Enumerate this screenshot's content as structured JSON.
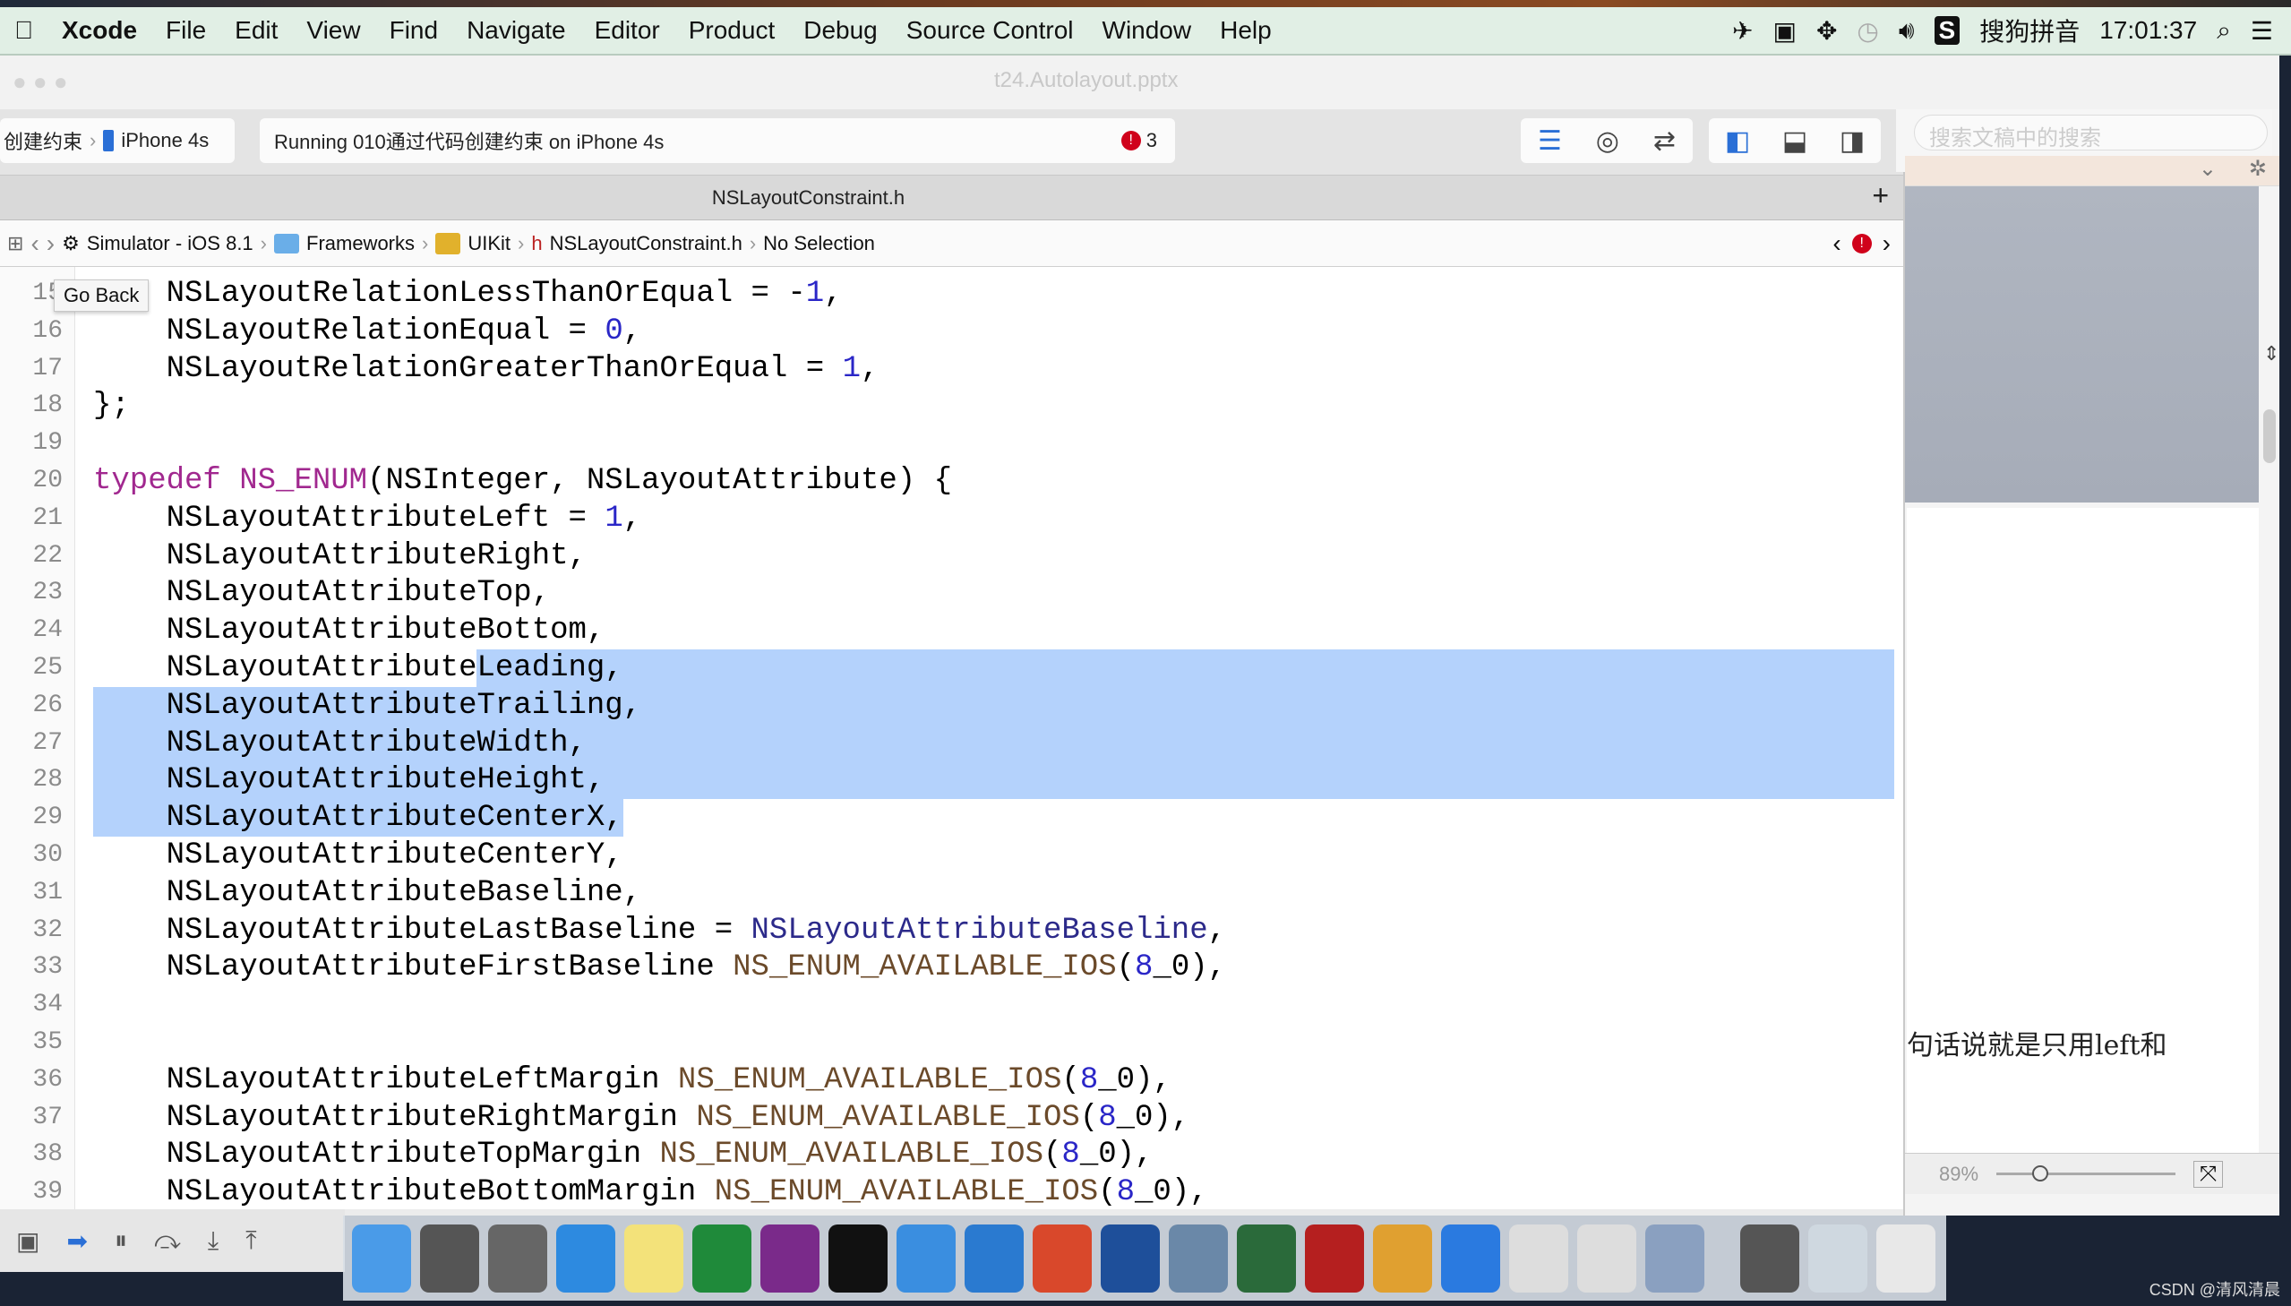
{
  "menubar": {
    "app": "Xcode",
    "items": [
      "File",
      "Edit",
      "View",
      "Find",
      "Navigate",
      "Editor",
      "Product",
      "Debug",
      "Source Control",
      "Window",
      "Help"
    ],
    "ime": "搜狗拼音",
    "clock": "17:01:37"
  },
  "window": {
    "title": "t24.Autolayout.pptx"
  },
  "toolbar": {
    "scheme": "创建约束",
    "device": "iPhone 4s",
    "status": "Running 010通过代码创建约束 on iPhone 4s",
    "error_count": "3"
  },
  "tab": {
    "title": "NSLayoutConstraint.h"
  },
  "jumpbar": {
    "items": [
      "Simulator - iOS 8.1",
      "Frameworks",
      "UIKit",
      "NSLayoutConstraint.h",
      "No Selection"
    ]
  },
  "tooltip": "Go Back",
  "code": [
    {
      "n": "15",
      "t": [
        [
          "NSLayoutRelationLessThanOrEqual = -",
          ""
        ],
        [
          "1",
          "num"
        ],
        [
          ",",
          ""
        ]
      ],
      "indent": 1
    },
    {
      "n": "16",
      "t": [
        [
          "NSLayoutRelationEqual = ",
          ""
        ],
        [
          "0",
          "num"
        ],
        [
          ",",
          ""
        ]
      ],
      "indent": 1
    },
    {
      "n": "17",
      "t": [
        [
          "NSLayoutRelationGreaterThanOrEqual = ",
          ""
        ],
        [
          "1",
          "num"
        ],
        [
          ",",
          ""
        ]
      ],
      "indent": 1
    },
    {
      "n": "18",
      "t": [
        [
          "};",
          ""
        ]
      ],
      "indent": 0
    },
    {
      "n": "19",
      "t": [],
      "indent": 0
    },
    {
      "n": "20",
      "t": [
        [
          "typedef",
          "kw"
        ],
        [
          " ",
          ""
        ],
        [
          "NS_ENUM",
          "kw"
        ],
        [
          "(NSInteger, NSLayoutAttribute) {",
          ""
        ]
      ],
      "indent": 0
    },
    {
      "n": "21",
      "t": [
        [
          "NSLayoutAttributeLeft = ",
          ""
        ],
        [
          "1",
          "num"
        ],
        [
          ",",
          ""
        ]
      ],
      "indent": 1
    },
    {
      "n": "22",
      "t": [
        [
          "NSLayoutAttributeRight,",
          ""
        ]
      ],
      "indent": 1
    },
    {
      "n": "23",
      "t": [
        [
          "NSLayoutAttributeTop,",
          ""
        ]
      ],
      "indent": 1
    },
    {
      "n": "24",
      "t": [
        [
          "NSLayoutAttributeBottom,",
          ""
        ]
      ],
      "indent": 1
    },
    {
      "n": "25",
      "t": [
        [
          "NSLayoutAttributeLeading,",
          ""
        ]
      ],
      "indent": 1
    },
    {
      "n": "26",
      "t": [
        [
          "NSLayoutAttributeTrailing,",
          ""
        ]
      ],
      "indent": 1
    },
    {
      "n": "27",
      "t": [
        [
          "NSLayoutAttributeWidth,",
          ""
        ]
      ],
      "indent": 1
    },
    {
      "n": "28",
      "t": [
        [
          "NSLayoutAttributeHeight,",
          ""
        ]
      ],
      "indent": 1
    },
    {
      "n": "29",
      "t": [
        [
          "NSLayoutAttributeCenterX,",
          ""
        ]
      ],
      "indent": 1
    },
    {
      "n": "30",
      "t": [
        [
          "NSLayoutAttributeCenterY,",
          ""
        ]
      ],
      "indent": 1
    },
    {
      "n": "31",
      "t": [
        [
          "NSLayoutAttributeBaseline,",
          ""
        ]
      ],
      "indent": 1
    },
    {
      "n": "32",
      "t": [
        [
          "NSLayoutAttributeLastBaseline = ",
          ""
        ],
        [
          "NSLayoutAttributeBaseline",
          "ref"
        ],
        [
          ",",
          ""
        ]
      ],
      "indent": 1
    },
    {
      "n": "33",
      "t": [
        [
          "NSLayoutAttributeFirstBaseline ",
          ""
        ],
        [
          "NS_ENUM_AVAILABLE_IOS",
          "mac"
        ],
        [
          "(",
          ""
        ],
        [
          "8",
          "num"
        ],
        [
          "_0),",
          ""
        ]
      ],
      "indent": 1
    },
    {
      "n": "34",
      "t": [],
      "indent": 0
    },
    {
      "n": "35",
      "t": [],
      "indent": 0
    },
    {
      "n": "36",
      "t": [
        [
          "NSLayoutAttributeLeftMargin ",
          ""
        ],
        [
          "NS_ENUM_AVAILABLE_IOS",
          "mac"
        ],
        [
          "(",
          ""
        ],
        [
          "8",
          "num"
        ],
        [
          "_0),",
          ""
        ]
      ],
      "indent": 1
    },
    {
      "n": "37",
      "t": [
        [
          "NSLayoutAttributeRightMargin ",
          ""
        ],
        [
          "NS_ENUM_AVAILABLE_IOS",
          "mac"
        ],
        [
          "(",
          ""
        ],
        [
          "8",
          "num"
        ],
        [
          "_0),",
          ""
        ]
      ],
      "indent": 1
    },
    {
      "n": "38",
      "t": [
        [
          "NSLayoutAttributeTopMargin ",
          ""
        ],
        [
          "NS_ENUM_AVAILABLE_IOS",
          "mac"
        ],
        [
          "(",
          ""
        ],
        [
          "8",
          "num"
        ],
        [
          "_0),",
          ""
        ]
      ],
      "indent": 1
    },
    {
      "n": "39",
      "t": [
        [
          "NSLayoutAttributeBottomMargin ",
          ""
        ],
        [
          "NS_ENUM_AVAILABLE_IOS",
          "mac"
        ],
        [
          "(",
          ""
        ],
        [
          "8",
          "num"
        ],
        [
          "_0),",
          ""
        ]
      ],
      "indent": 1
    }
  ],
  "selection": {
    "from_line": "25",
    "to_line": "29"
  },
  "rightpanel": {
    "search_placeholder": "搜索文稿中的搜索",
    "note_text": "句话说就是只用left和",
    "zoom": "89%"
  },
  "dock": {
    "icons": [
      "finder",
      "system-preferences",
      "launchpad",
      "safari",
      "notes",
      "excel",
      "onenote",
      "terminal",
      "xcode",
      "preview",
      "powerpoint",
      "scissors",
      "photo-viewer",
      "time-machine",
      "filezilla",
      "sketch",
      "word",
      "font-a",
      "font-b",
      "disk-utility",
      "screenshot",
      "preview-2",
      "trash"
    ]
  },
  "watermark": "CSDN @清风清晨",
  "colors": {
    "selection": "#b4d2fc",
    "keyword": "#a1288f",
    "number": "#2a26c7",
    "macro": "#6b4a2a",
    "error": "#d0021b"
  }
}
